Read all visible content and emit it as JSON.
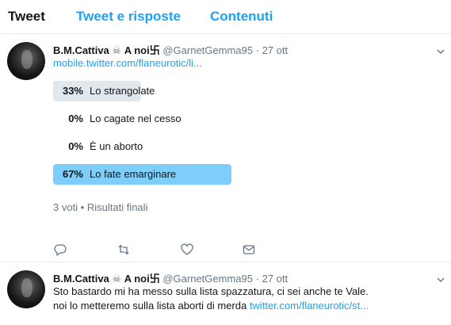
{
  "tabs": {
    "tweet": "Tweet",
    "replies": "Tweet e risposte",
    "media": "Contenuti"
  },
  "tweets": [
    {
      "name": "B.M.Cattiva",
      "emoji": "☠",
      "suffix": "A noi卐",
      "handle": "@GarnetGemma95",
      "sep": "·",
      "date": "27 ott",
      "link": "mobile.twitter.com/flaneurotic/li...",
      "poll": [
        {
          "pct": "33%",
          "label": "Lo strangolate",
          "share": 0.33,
          "winner": false
        },
        {
          "pct": "0%",
          "label": "Lo cagate nel cesso",
          "share": 0,
          "winner": false
        },
        {
          "pct": "0%",
          "label": "È un aborto",
          "share": 0,
          "winner": false
        },
        {
          "pct": "67%",
          "label": "Lo fate emarginare",
          "share": 0.67,
          "winner": true
        }
      ],
      "meta": "3 voti • Risultati finali"
    },
    {
      "name": "B.M.Cattiva",
      "emoji": "☠",
      "suffix": "A noi卐",
      "handle": "@GarnetGemma95",
      "sep": "·",
      "date": "27 ott",
      "line1": "Sto bastardo mi ha messo sulla lista spazzatura, ci sei anche te Vale.",
      "line2_text": "noi lo metteremo sulla lista aborti di merda ",
      "line2_link": "twitter.com/flaneurotic/st..."
    }
  ],
  "colors": {
    "accent": "#1da1f2",
    "poll_bar": "#e1e8ed",
    "poll_winner": "#7fcdf9",
    "muted": "#657786"
  }
}
